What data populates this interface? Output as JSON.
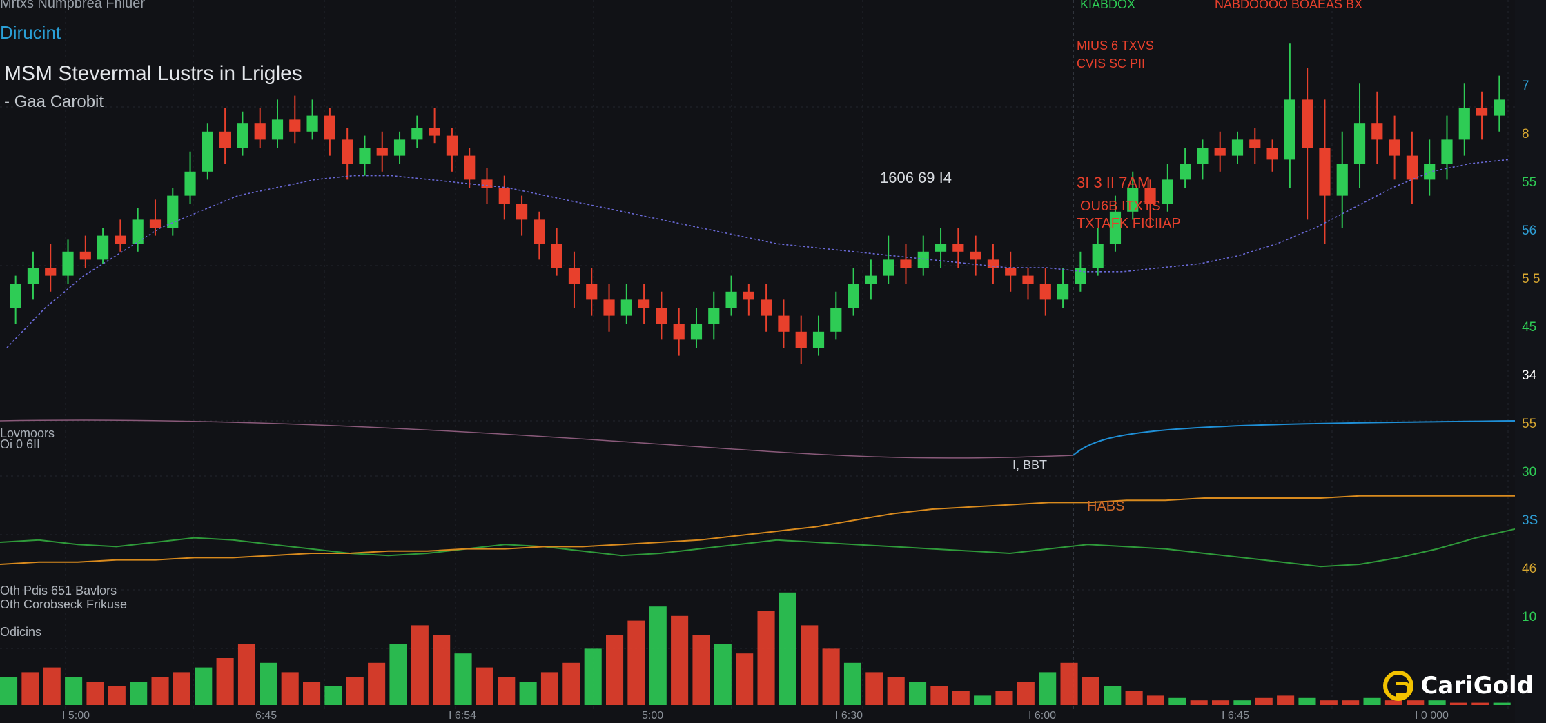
{
  "header": {
    "top_text": "Mrtxs Numpbrea Fhiuer",
    "brand": "Dirucint",
    "title": "MSM Stevermal Lustrs in Lrigles",
    "subtitle": "- Gaa Carobit"
  },
  "logo": {
    "text": "CariGold",
    "icon": "cg-ring-icon"
  },
  "colors": {
    "background": "#111216",
    "up": "#2ecc55",
    "down": "#e8402c",
    "ma_purple": "#6a6ad8",
    "line_mauve": "#8a5a7a",
    "line_blue": "#1f8fd6",
    "line_orange": "#d88a1e",
    "line_green": "#2f9a3a",
    "line_yellow": "#b8a020",
    "price_axis_bg": "#0f6f8f"
  },
  "chart_data": [
    {
      "type": "candlestick",
      "panel": "main",
      "title": "MSM Stevermal Lustrs in Lrigles",
      "subtitle": "- Gaa Carobit",
      "x_count": 86,
      "y_range": [
        0,
        100
      ],
      "candles": [
        [
          30,
          36,
          38,
          26
        ],
        [
          36,
          40,
          44,
          32
        ],
        [
          40,
          38,
          46,
          34
        ],
        [
          38,
          44,
          47,
          36
        ],
        [
          44,
          42,
          48,
          40
        ],
        [
          42,
          48,
          50,
          41
        ],
        [
          48,
          46,
          52,
          44
        ],
        [
          46,
          52,
          55,
          44
        ],
        [
          52,
          50,
          57,
          48
        ],
        [
          50,
          58,
          60,
          48
        ],
        [
          58,
          64,
          69,
          56
        ],
        [
          64,
          74,
          76,
          62
        ],
        [
          74,
          70,
          80,
          66
        ],
        [
          70,
          76,
          79,
          68
        ],
        [
          76,
          72,
          80,
          70
        ],
        [
          72,
          77,
          82,
          70
        ],
        [
          77,
          74,
          83,
          71
        ],
        [
          74,
          78,
          82,
          72
        ],
        [
          78,
          72,
          80,
          68
        ],
        [
          72,
          66,
          75,
          62
        ],
        [
          66,
          70,
          73,
          63
        ],
        [
          70,
          68,
          74,
          64
        ],
        [
          68,
          72,
          74,
          66
        ],
        [
          72,
          75,
          78,
          70
        ],
        [
          75,
          73,
          80,
          71
        ],
        [
          73,
          68,
          75,
          64
        ],
        [
          68,
          62,
          70,
          60
        ],
        [
          62,
          60,
          65,
          56
        ],
        [
          60,
          56,
          63,
          52
        ],
        [
          56,
          52,
          58,
          48
        ],
        [
          52,
          46,
          54,
          42
        ],
        [
          46,
          40,
          50,
          38
        ],
        [
          40,
          36,
          44,
          30
        ],
        [
          36,
          32,
          40,
          28
        ],
        [
          32,
          28,
          36,
          24
        ],
        [
          28,
          32,
          36,
          26
        ],
        [
          32,
          30,
          36,
          26
        ],
        [
          30,
          26,
          34,
          22
        ],
        [
          26,
          22,
          30,
          18
        ],
        [
          22,
          26,
          30,
          20
        ],
        [
          26,
          30,
          34,
          22
        ],
        [
          30,
          34,
          38,
          28
        ],
        [
          34,
          32,
          36,
          28
        ],
        [
          32,
          28,
          36,
          24
        ],
        [
          28,
          24,
          32,
          20
        ],
        [
          24,
          20,
          28,
          16
        ],
        [
          20,
          24,
          28,
          18
        ],
        [
          24,
          30,
          34,
          22
        ],
        [
          30,
          36,
          40,
          28
        ],
        [
          36,
          38,
          42,
          32
        ],
        [
          38,
          42,
          48,
          36
        ],
        [
          42,
          40,
          46,
          36
        ],
        [
          40,
          44,
          48,
          38
        ],
        [
          44,
          46,
          50,
          40
        ],
        [
          46,
          44,
          50,
          40
        ],
        [
          44,
          42,
          48,
          38
        ],
        [
          42,
          40,
          46,
          36
        ],
        [
          40,
          38,
          44,
          34
        ],
        [
          38,
          36,
          40,
          32
        ],
        [
          36,
          32,
          40,
          28
        ],
        [
          32,
          36,
          40,
          30
        ],
        [
          36,
          40,
          44,
          34
        ],
        [
          40,
          46,
          50,
          38
        ],
        [
          46,
          54,
          58,
          44
        ],
        [
          54,
          60,
          64,
          52
        ],
        [
          60,
          56,
          62,
          50
        ],
        [
          56,
          62,
          66,
          54
        ],
        [
          62,
          66,
          70,
          60
        ],
        [
          66,
          70,
          72,
          62
        ],
        [
          70,
          68,
          74,
          64
        ],
        [
          68,
          72,
          74,
          66
        ],
        [
          72,
          70,
          75,
          66
        ],
        [
          70,
          67,
          72,
          64
        ],
        [
          67,
          82,
          96,
          60
        ],
        [
          82,
          70,
          90,
          52
        ],
        [
          70,
          58,
          82,
          46
        ],
        [
          58,
          66,
          74,
          50
        ],
        [
          66,
          76,
          86,
          60
        ],
        [
          76,
          72,
          84,
          66
        ],
        [
          72,
          68,
          78,
          62
        ],
        [
          68,
          62,
          74,
          56
        ],
        [
          62,
          66,
          72,
          58
        ],
        [
          66,
          72,
          78,
          62
        ],
        [
          72,
          80,
          86,
          68
        ],
        [
          80,
          78,
          84,
          72
        ],
        [
          78,
          82,
          88,
          74
        ]
      ],
      "moving_average": [
        20,
        30,
        38,
        44,
        50,
        54,
        58,
        60,
        62,
        63,
        63,
        62,
        61,
        60,
        58,
        56,
        54,
        52,
        50,
        48,
        46,
        45,
        44,
        43,
        42,
        41,
        40,
        40,
        39,
        39,
        40,
        41,
        43,
        46,
        50,
        55,
        60,
        64,
        66,
        67
      ],
      "annotations": [
        "1606 69 I4",
        "3I 3 II 7AM",
        "OU6B ITXTS",
        "TXTAFK FICIIAP",
        "MIUS 6 TXVS",
        "CVIS SC PII",
        "KIABDOX",
        "NABDOOOO BOAEAS BX",
        "I, BBT",
        "Lovmoors",
        "Oi 0 6II"
      ],
      "price_axis_labels": [
        "7",
        "8",
        "55",
        "56",
        "5 5",
        "45",
        "34",
        "55",
        "30",
        "3S",
        "46",
        "10"
      ]
    },
    {
      "type": "line",
      "panel": "oscillator",
      "label": "HABS",
      "series": [
        {
          "name": "",
          "values": [
            40,
            42,
            38,
            36,
            40,
            44,
            42,
            38,
            34,
            30,
            28,
            30,
            34,
            38,
            36,
            32,
            28,
            30,
            34,
            38,
            42,
            40,
            38,
            36,
            34,
            32,
            30,
            34,
            38,
            36,
            34,
            30,
            26,
            22,
            18,
            20,
            26,
            34,
            44,
            52
          ]
        },
        {
          "name": "",
          "values": [
            20,
            22,
            22,
            24,
            24,
            26,
            26,
            28,
            30,
            30,
            32,
            32,
            34,
            34,
            36,
            36,
            38,
            40,
            42,
            46,
            50,
            54,
            60,
            66,
            70,
            72,
            74,
            76,
            76,
            78,
            78,
            80,
            80,
            80,
            80,
            82,
            82,
            82,
            82,
            82
          ]
        }
      ]
    },
    {
      "type": "bar",
      "panel": "volume",
      "label": "Oth Pdis 651 Bavlors",
      "label2": "Oth Corobseck Frikuse",
      "label3": "Odicins",
      "values": [
        12,
        14,
        16,
        12,
        10,
        8,
        10,
        12,
        14,
        16,
        20,
        26,
        18,
        14,
        10,
        8,
        12,
        18,
        26,
        34,
        30,
        22,
        16,
        12,
        10,
        14,
        18,
        24,
        30,
        36,
        42,
        38,
        30,
        26,
        22,
        40,
        48,
        34,
        24,
        18,
        14,
        12,
        10,
        8,
        6,
        4,
        6,
        10,
        14,
        18,
        12,
        8,
        6,
        4,
        3,
        2,
        2,
        2,
        3,
        4,
        3,
        2,
        2,
        3,
        2,
        2,
        2,
        1,
        1,
        1
      ]
    }
  ],
  "time_axis_labels": [
    "I 5:00",
    "6:45",
    "I 6:54",
    "5:00",
    "I 6:30",
    "I 6:00",
    "I 6:45",
    "I 0 000"
  ]
}
